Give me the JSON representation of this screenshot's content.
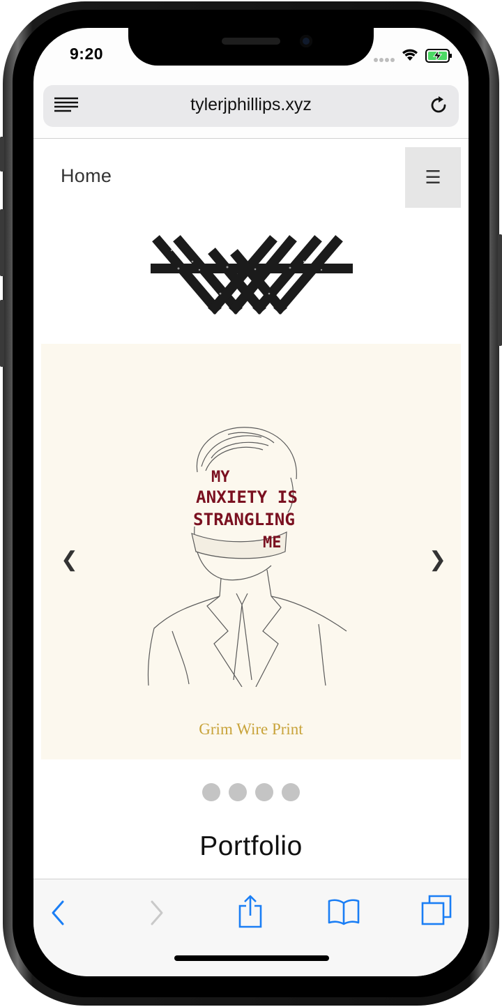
{
  "status_bar": {
    "time": "9:20"
  },
  "browser": {
    "url": "tylerjphillips.xyz"
  },
  "site": {
    "nav_home": "Home",
    "menu_glyph": "☰",
    "carousel": {
      "caption": "Grim Wire Print",
      "art_text": [
        "MY",
        "ANXIETY IS",
        "STRANGLING",
        "ME"
      ],
      "prev_arrow": "❮",
      "next_arrow": "❯",
      "slide_count": 4
    },
    "section_heading": "Portfolio"
  },
  "colors": {
    "accent_blue": "#1a7ef5",
    "caption_gold": "#c8a33a",
    "art_ink": "#7a1020",
    "slide_background": "#fcf8ee"
  },
  "toolbar": {
    "icons": [
      "back-icon",
      "forward-icon",
      "share-icon",
      "bookmarks-icon",
      "tabs-icon"
    ]
  }
}
